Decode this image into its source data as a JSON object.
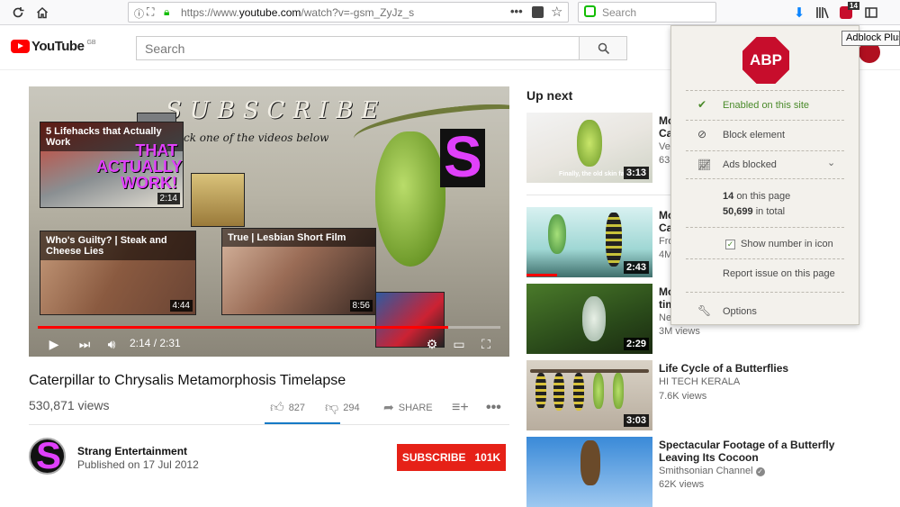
{
  "browser": {
    "url_prefix": "https://www.",
    "url_domain": "youtube.com",
    "url_path": "/watch?v=-gsm_ZyJz_s",
    "search_placeholder": "Search",
    "abp_badge": "14",
    "abp_tooltip": "Adblock Plus"
  },
  "youtube": {
    "logo_text": "YouTube",
    "logo_region": "GB",
    "search_placeholder": "Search"
  },
  "player": {
    "overlay_text": "SUBSCRIBE",
    "overlay_subtext": "ck one of the videos below",
    "time": "2:14 / 2:31",
    "progress_fraction": 0.888,
    "end_cards": [
      {
        "title": "5 Lifehacks that Actually Work",
        "big_text": "THAT ACTUALLY WORK!",
        "duration": "2:14"
      },
      {
        "title": "Who's Guilty? | Steak and Cheese Lies",
        "duration": "4:44"
      },
      {
        "title": "True | Lesbian Short Film",
        "duration": "8:56"
      }
    ]
  },
  "video": {
    "title": "Caterpillar to Chrysalis Metamorphosis Timelapse",
    "views": "530,871 views",
    "likes": "827",
    "dislikes": "294",
    "share_label": "SHARE",
    "channel_name": "Strang Entertainment",
    "published": "Published on 17 Jul 2012",
    "subscribe_label": "SUBSCRIBE",
    "subscriber_count": "101K"
  },
  "up_next": {
    "label": "Up next",
    "items": [
      {
        "title": "Mo\nCa",
        "channel": "Ve",
        "views": "63",
        "duration": "3:13",
        "caption": "Finally, the old skin falls off."
      },
      {
        "title": "Mo\nCa",
        "channel": "Fro",
        "views": "4M",
        "duration": "2:43"
      },
      {
        "title": "Mo\ntim",
        "channel": "Ne",
        "views": "3M views",
        "duration": "2:29"
      },
      {
        "title": "Life Cycle of a Butterflies",
        "channel": "HI TECH KERALA",
        "views": "7.6K views",
        "duration": "3:03"
      },
      {
        "title": "Spectacular Footage of a Butterfly Leaving Its Cocoon",
        "channel": "Smithsonian Channel",
        "views": "62K views",
        "duration": ""
      }
    ]
  },
  "abp": {
    "logo": "ABP",
    "enabled_text": "Enabled",
    "enabled_suffix": "on this site",
    "block_element": "Block element",
    "ads_blocked": "Ads blocked",
    "page_count": "14",
    "page_suffix": "on this page",
    "total_count": "50,699",
    "total_suffix": "in total",
    "show_number": "Show number in icon",
    "report_issue": "Report issue on this page",
    "options": "Options"
  },
  "colors": {
    "youtube_red": "#ff0000",
    "subscribe_red": "#e62117",
    "abp_red": "#c70d2c",
    "abp_green": "#4a8a2a",
    "link_blue": "#167ac6"
  }
}
